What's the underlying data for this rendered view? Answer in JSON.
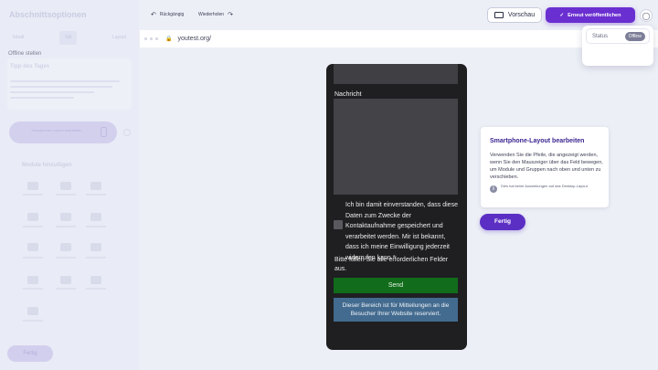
{
  "sidebar": {
    "title": "Abschnittsoptionen",
    "tabs": [
      "Inhalt",
      "Stil",
      "Layout"
    ],
    "card_title": "Tipp des Tages",
    "pill_text": "Smartphone-Layout bearbeiten",
    "section_title": "Module hinzufügen",
    "done_label": "Fertig"
  },
  "toolbar": {
    "undo_label": "Rückgängig",
    "redo_label": "Wiederholen",
    "preview_label": "Vorschau",
    "publish_label": "Erneut veröffentlichen"
  },
  "addressbar": {
    "url": "youtest.org/"
  },
  "status_menu": {
    "label": "Status",
    "badge": "Offline",
    "action": "Offline stellen"
  },
  "phone": {
    "message_label": "Nachricht",
    "consent_text": "Ich bin damit einverstanden, dass diese Daten zum Zwecke der Kontaktaufnahme gespeichert und verarbeitet werden. Mir ist bekannt, dass ich meine Einwilligung jederzeit widerrufen kann.*",
    "required_note": "Bitte füllen Sie alle erforderlichen Felder aus.",
    "send_label": "Send",
    "notice_text": "Dieser Bereich ist für Mitteilungen an die Besucher Ihrer Website reserviert."
  },
  "tooltip": {
    "title": "Smartphone-Layout bearbeiten",
    "body": "Verwenden Sie die Pfeile, die angezeigt werden, wenn Sie den Mauszeiger über das Feld bewegen, um Module und Gruppen nach oben und unten zu verschieben.",
    "info": "Dies hat keine Auswirkungen auf das Desktop-Layout.",
    "done_label": "Fertig"
  },
  "colors": {
    "accent": "#6a2fd0",
    "send_button": "#116c1b",
    "notice": "#436b8f",
    "phone_bg": "#1f1f22"
  },
  "icons": [
    "undo-icon",
    "redo-icon",
    "device-icon",
    "check-icon",
    "globe-icon",
    "lock-icon",
    "info-icon"
  ]
}
